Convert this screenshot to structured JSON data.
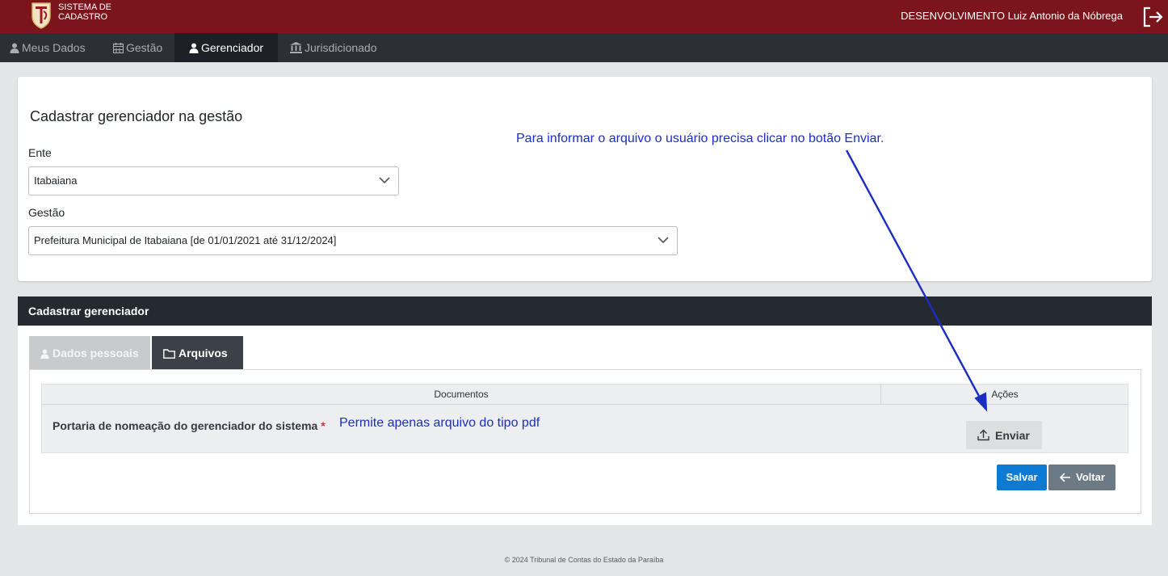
{
  "header": {
    "brand_line1": "SISTEMA DE",
    "brand_line2": "CADASTRO",
    "user": "DESENVOLVIMENTO Luiz Antonio da Nóbrega"
  },
  "nav": {
    "items": [
      {
        "label": "Meus Dados",
        "icon": "user-icon"
      },
      {
        "label": "Gestão",
        "icon": "calendar-icon"
      },
      {
        "label": "Gerenciador",
        "icon": "user-icon",
        "active": true
      },
      {
        "label": "Jurisdicionado",
        "icon": "bank-icon"
      }
    ]
  },
  "form": {
    "title": "Cadastrar gerenciador na gestão",
    "ente_label": "Ente",
    "ente_value": "Itabaiana",
    "gestao_label": "Gestão",
    "gestao_value": "Prefeitura Municipal de Itabaiana [de 01/01/2021 até 31/12/2024]"
  },
  "annotations": {
    "top": "Para informar o arquivo o usuário precisa clicar no botão Enviar.",
    "pdf": "Permite apenas arquivo do tipo pdf",
    "color": "#1b2ec2"
  },
  "register": {
    "title": "Cadastrar gerenciador",
    "tabs": [
      {
        "label": "Dados pessoais",
        "icon": "user-icon"
      },
      {
        "label": "Arquivos",
        "icon": "folder-icon",
        "active": true
      }
    ],
    "table": {
      "col_docs": "Documentos",
      "col_actions": "Ações",
      "row_label": "Portaria de nomeação do gerenciador do sistema",
      "required_mark": "*",
      "upload_label": "Enviar"
    },
    "save_label": "Salvar",
    "back_label": "Voltar"
  },
  "footer": "© 2024 Tribunal de Contas do Estado da Paraíba",
  "colors": {
    "topbar": "#7b141b",
    "nav": "#2c3035",
    "primary": "#0d7bd4",
    "secondary": "#6c7a85"
  }
}
